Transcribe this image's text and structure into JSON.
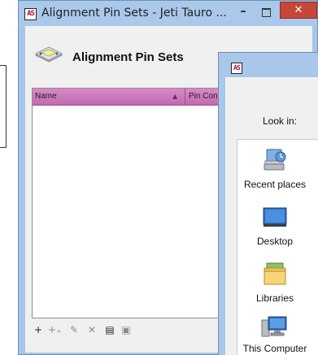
{
  "window": {
    "title": "Alignment Pin Sets - Jeti Tauro ...",
    "app_icon_text": "AS",
    "minimize_glyph": "–",
    "close_glyph": "✕"
  },
  "header": {
    "title": "Alignment Pin Sets",
    "icon": "alignment-pin-set-icon"
  },
  "grid": {
    "columns": [
      {
        "label": "Name",
        "sorted": "ascending"
      },
      {
        "label": "Pin Con"
      }
    ],
    "sort_glyph": "▲",
    "rows": []
  },
  "toolbar": {
    "buttons": [
      {
        "name": "add-icon",
        "glyph": "+",
        "enabled": true
      },
      {
        "name": "add-multiple-icon",
        "glyph": "+₊",
        "enabled": false
      },
      {
        "name": "edit-icon",
        "glyph": "✎",
        "enabled": false
      },
      {
        "name": "delete-icon",
        "glyph": "✕",
        "enabled": false
      },
      {
        "name": "import-icon",
        "glyph": "▤",
        "enabled": true
      },
      {
        "name": "save-icon",
        "glyph": "▣",
        "enabled": false
      }
    ]
  },
  "dialog": {
    "app_icon_text": "AS",
    "look_in_label": "Look in:",
    "places": [
      {
        "label": "Recent places",
        "icon": "recent-places-icon"
      },
      {
        "label": "Desktop",
        "icon": "desktop-icon"
      },
      {
        "label": "Libraries",
        "icon": "libraries-icon"
      },
      {
        "label": "This Computer",
        "icon": "computer-icon"
      }
    ]
  },
  "colors": {
    "title_bar": "#a9c8ea",
    "close_button": "#c7463a",
    "grid_header": "#c36ab1"
  }
}
